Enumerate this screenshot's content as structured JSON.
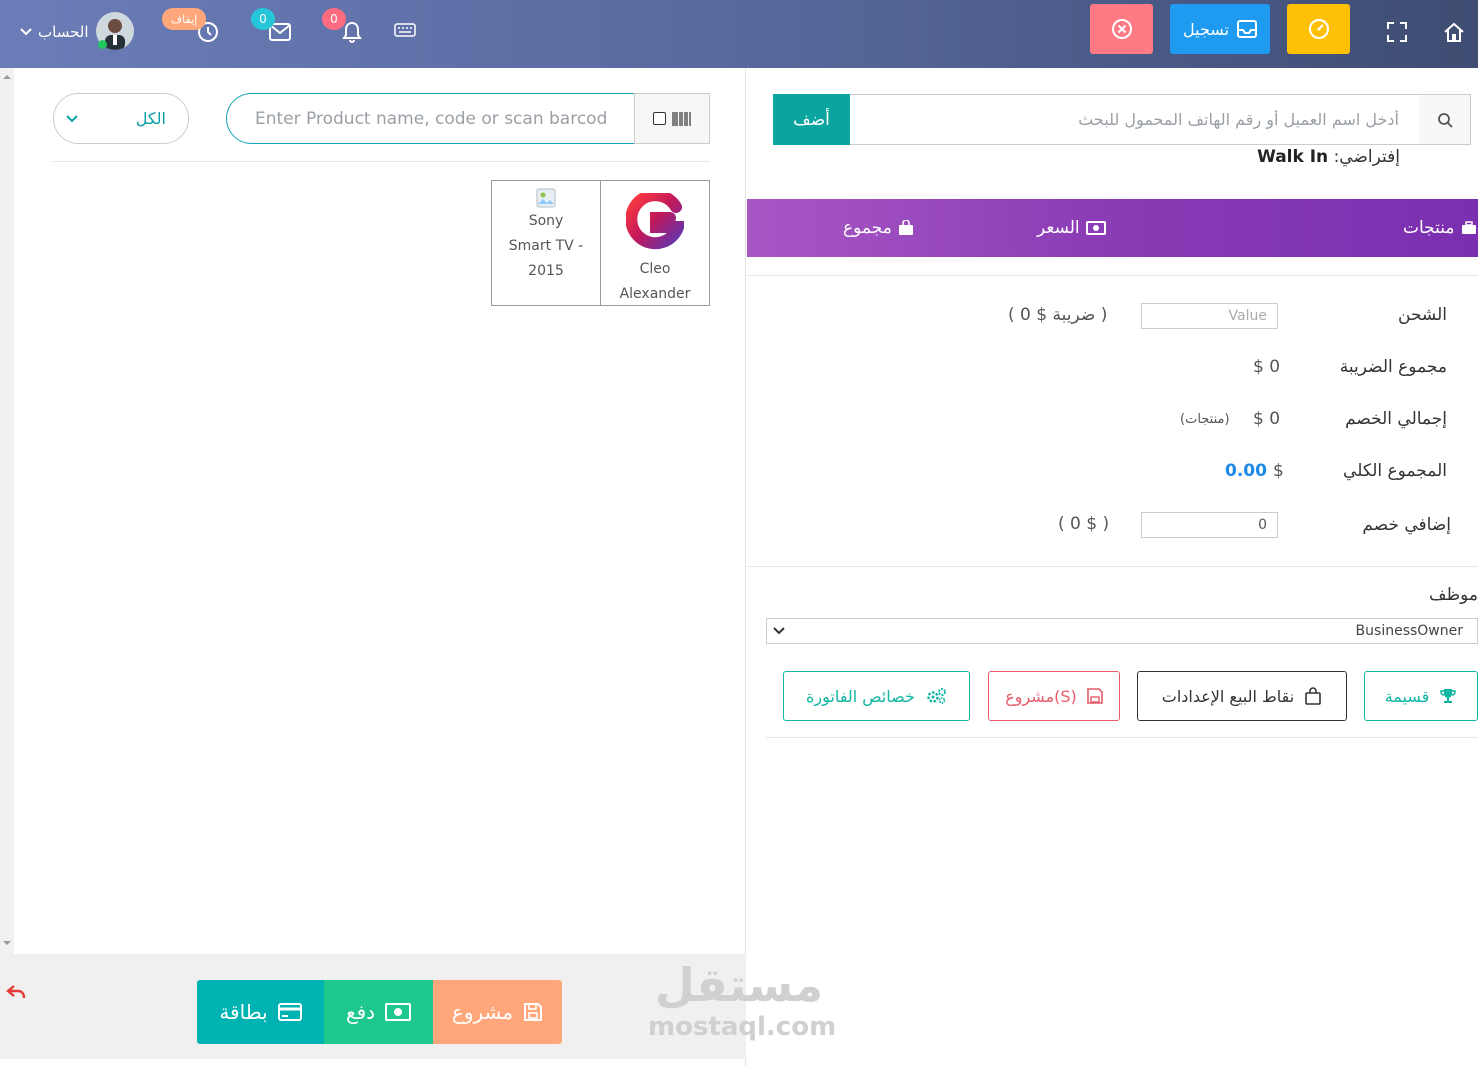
{
  "header": {
    "account_label": "الحساب",
    "badge_stop": "إيقاف",
    "badge_mail": "0",
    "badge_bell": "0",
    "register_label": "تسجيل"
  },
  "products_panel": {
    "category_selected": "الكل",
    "search_placeholder": "Enter Product name, code or scan barcode",
    "products": [
      {
        "name_line1": "Sony",
        "name_line2": "Smart TV -",
        "name_line3": "2015"
      },
      {
        "name_line1": "Cleo",
        "name_line2": "Alexander"
      }
    ]
  },
  "payment_bar": {
    "card_label": "بطاقة",
    "pay_label": "دفع",
    "draft_label": "مشروع"
  },
  "customer": {
    "search_placeholder": "أدخل اسم العميل أو رقم الهاتف المحمول للبحث",
    "add_label": "أضف",
    "default_label": "إفتراضي:",
    "default_value": "Walk In"
  },
  "cart_header": {
    "products": "منتجات",
    "price": "السعر",
    "total": "مجموع"
  },
  "summary": {
    "shipping_label": "الشحن",
    "shipping_placeholder": "Value",
    "tax_note": "( ضريبة $ 0 )",
    "tax_total_label": "مجموع الضريبة",
    "tax_total_value": "$ 0",
    "discount_total_label": "إجمالي الخصم",
    "discount_total_value": "$ 0",
    "discount_note": "(منتجات)",
    "grand_total_label": "المجموع الكلي",
    "grand_total_currency": "$",
    "grand_total_value": "0.00",
    "extra_discount_label": "إضافي خصم",
    "extra_discount_value": "0",
    "extra_discount_note": "( $ 0 )"
  },
  "employee": {
    "label": "موظف",
    "selected": "BusinessOwner"
  },
  "actions": {
    "coupon": "قسيمة",
    "pos_settings": "نقاط البيع الإعدادات",
    "drafts": "مشروع(S)",
    "invoice_props": "خصائص الفاتورة"
  },
  "watermark": {
    "arabic": "مستقل",
    "latin": "mostaql.com"
  },
  "colors": {
    "teal": "#0ba5a0",
    "purple": "#8a3bb5",
    "total_blue": "#1e88e5"
  }
}
